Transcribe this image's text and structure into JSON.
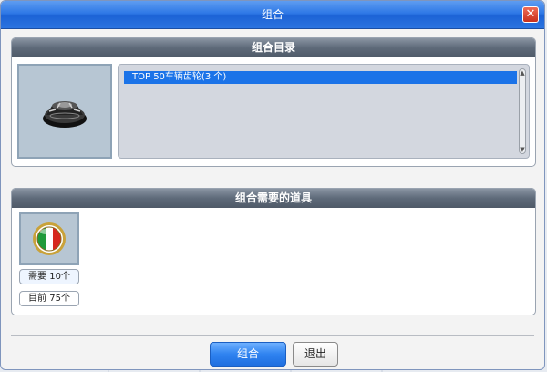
{
  "dialog": {
    "title": "组合",
    "close_symbol": "✕"
  },
  "catalog_panel": {
    "header": "组合目录",
    "item_image_icon": "gear-part-icon",
    "list": {
      "selected_item": "TOP 50车辆齿轮(3 个)"
    },
    "scroll_up_symbol": "▲",
    "scroll_down_symbol": "▼"
  },
  "materials_panel": {
    "header": "组合需要的道具",
    "material_icon": "italy-flag-badge-icon",
    "required_label": "需要 10个",
    "current_label": "目前 75个"
  },
  "footer": {
    "combine_button": "组合",
    "exit_button": "退出"
  },
  "colors": {
    "titlebar": "#2e78e6",
    "selected_row": "#1b73e8",
    "panel_header": "#5e6a79"
  }
}
